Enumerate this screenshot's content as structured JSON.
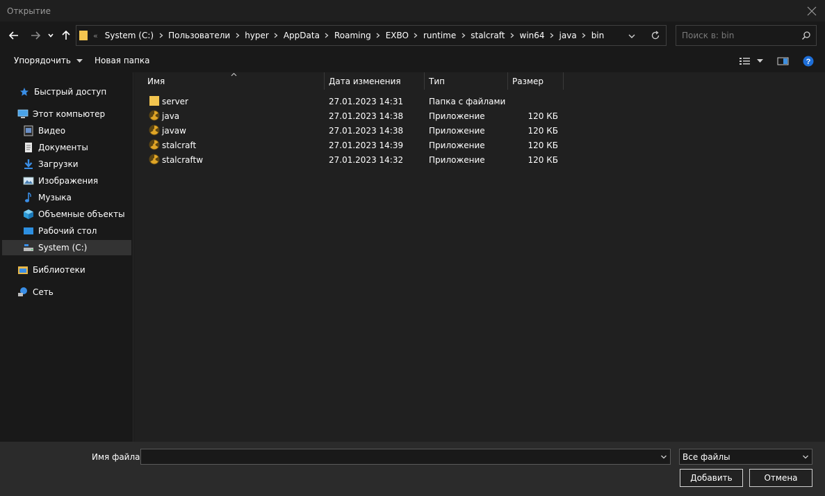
{
  "window": {
    "title": "Открытие"
  },
  "address": {
    "lead_chevron": "«",
    "crumbs": [
      "System (C:)",
      "Пользователи",
      "hyper",
      "AppData",
      "Roaming",
      "EXBO",
      "runtime",
      "stalcraft",
      "win64",
      "java",
      "bin"
    ]
  },
  "search": {
    "placeholder": "Поиск в: bin"
  },
  "toolbar": {
    "organize": "Упорядочить",
    "new_folder": "Новая папка"
  },
  "nav": {
    "quick_access": "Быстрый доступ",
    "this_pc": "Этот компьютер",
    "video": "Видео",
    "documents": "Документы",
    "downloads": "Загрузки",
    "pictures": "Изображения",
    "music": "Музыка",
    "objects3d": "Объемные объекты",
    "desktop": "Рабочий стол",
    "system_c": "System (C:)",
    "libraries": "Библиотеки",
    "network": "Сеть"
  },
  "columns": {
    "name": "Имя",
    "date": "Дата изменения",
    "type": "Тип",
    "size": "Размер"
  },
  "files": [
    {
      "name": "server",
      "date": "27.01.2023 14:31",
      "type": "Папка с файлами",
      "size": "",
      "icon": "folder-icon"
    },
    {
      "name": "java",
      "date": "27.01.2023 14:38",
      "type": "Приложение",
      "size": "120 КБ",
      "icon": "radiation-app-icon"
    },
    {
      "name": "javaw",
      "date": "27.01.2023 14:38",
      "type": "Приложение",
      "size": "120 КБ",
      "icon": "radiation-app-icon"
    },
    {
      "name": "stalcraft",
      "date": "27.01.2023 14:39",
      "type": "Приложение",
      "size": "120 КБ",
      "icon": "radiation-app-icon"
    },
    {
      "name": "stalcraftw",
      "date": "27.01.2023 14:32",
      "type": "Приложение",
      "size": "120 КБ",
      "icon": "radiation-app-icon"
    }
  ],
  "bottom": {
    "filename_label": "Имя файла:",
    "filename_value": "",
    "filter_value": "Все файлы",
    "add_button": "Добавить",
    "cancel_button": "Отмена"
  },
  "colors": {
    "folder": "#f2c44f",
    "accent": "#1e90ff",
    "selected": "#333333"
  }
}
